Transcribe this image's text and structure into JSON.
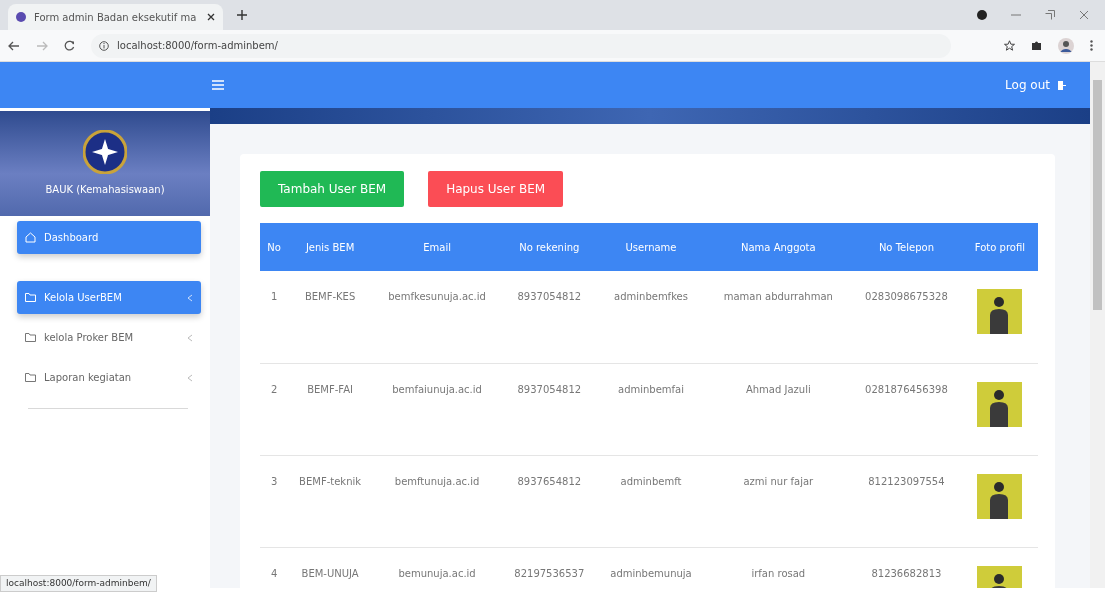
{
  "browser": {
    "tab_title": "Form admin Badan eksekutif ma",
    "url": "localhost:8000/form-adminbem/",
    "status_url": "localhost:8000/form-adminbem/"
  },
  "navbar": {
    "logout": "Log out"
  },
  "sidebar": {
    "brand": "BAUK (Kemahasiswaan)",
    "items": [
      {
        "label": "Dashboard",
        "selected": true,
        "kind": "link"
      },
      {
        "label": "Kelola UserBEM",
        "selected": true,
        "kind": "dropdown"
      },
      {
        "label": "kelola Proker BEM",
        "selected": false,
        "kind": "dropdown"
      },
      {
        "label": "Laporan kegiatan",
        "selected": false,
        "kind": "dropdown"
      }
    ]
  },
  "actions": [
    {
      "label": "Tambah User BEM",
      "kind": "add"
    },
    {
      "label": "Hapus User BEM",
      "kind": "delete"
    }
  ],
  "table": {
    "columns": [
      "No",
      "Jenis BEM",
      "Email",
      "No rekening",
      "Username",
      "Nama Anggota",
      "No Telepon",
      "Foto profil"
    ],
    "rows": [
      {
        "cells": [
          "1",
          "BEMF-KES",
          "bemfkesunuja.ac.id",
          "8937054812",
          "adminbemfkes",
          "maman abdurrahman",
          "0283098675328"
        ]
      },
      {
        "cells": [
          "2",
          "BEMF-FAI",
          "bemfaiunuja.ac.id",
          "8937054812",
          "adminbemfai",
          "Ahmad Jazuli",
          "0281876456398"
        ]
      },
      {
        "cells": [
          "3",
          "BEMF-teknik",
          "bemftunuja.ac.id",
          "8937654812",
          "adminbemft",
          "azmi nur fajar",
          "812123097554"
        ]
      },
      {
        "cells": [
          "4",
          "BEM-UNUJA",
          "bemunuja.ac.id",
          "82197536537",
          "adminbemunuja",
          "irfan rosad",
          "81236682813"
        ]
      }
    ]
  }
}
